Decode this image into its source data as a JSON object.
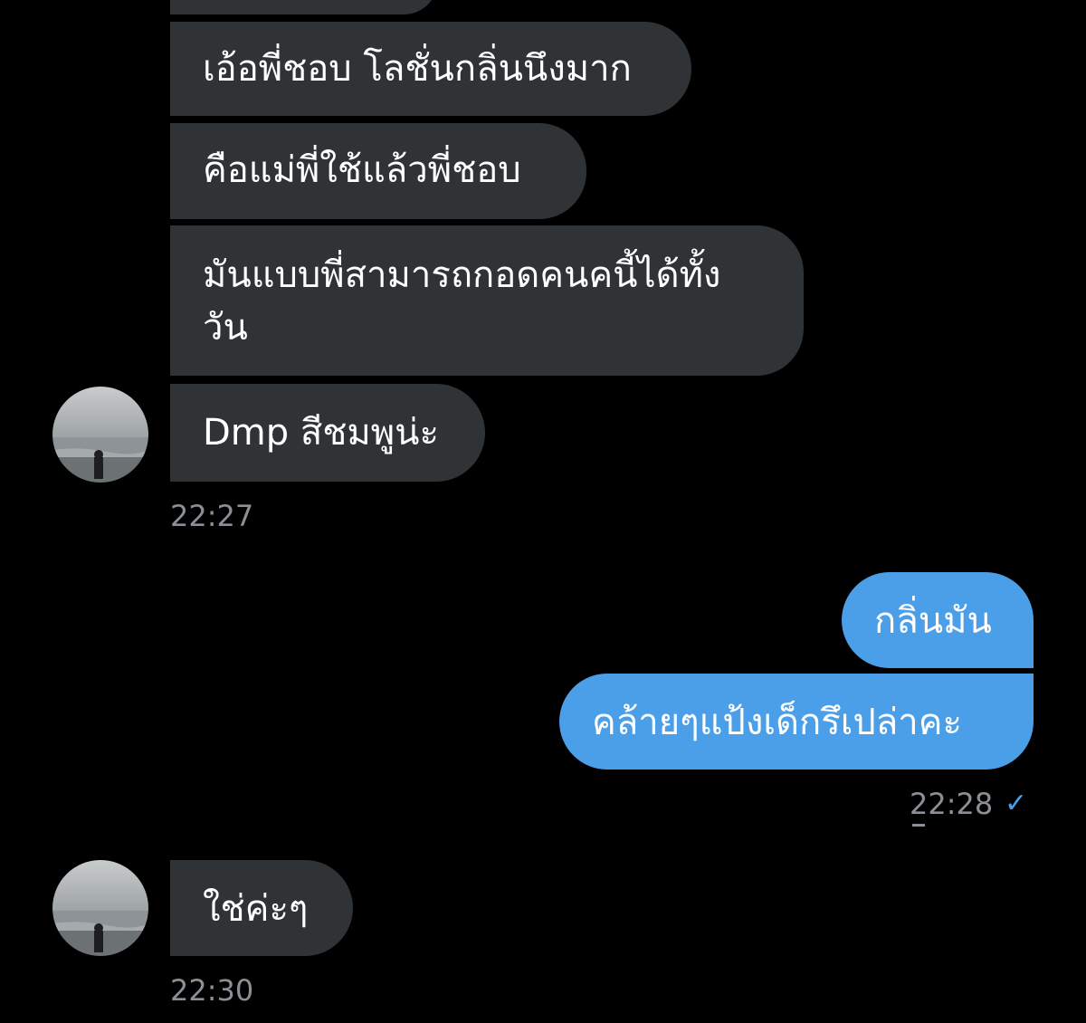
{
  "conversation": {
    "messages": [
      {
        "id": "m1",
        "sender": "other",
        "text": "เอ้อพี่ชอบ โลชั่นกลิ่นนึงมาก"
      },
      {
        "id": "m2",
        "sender": "other",
        "text": "คือแม่พี่ใช้แล้วพี่ชอบ"
      },
      {
        "id": "m3",
        "sender": "other",
        "lines": [
          "มันแบบพี่สามารถกอดคนคนี้ได้ทั้ง",
          "วัน"
        ]
      },
      {
        "id": "m4",
        "sender": "other",
        "text": "Dmp สีชมพูน่ะ"
      },
      {
        "id": "m5",
        "sender": "me",
        "text": "กลิ่นมัน"
      },
      {
        "id": "m6",
        "sender": "me",
        "text": "คล้ายๆแป้งเด็กรึเปล่าคะ"
      },
      {
        "id": "m7",
        "sender": "other",
        "text": "ใช่ค่ะๆ"
      }
    ],
    "timestamps": {
      "group1": "22:27",
      "group2": "22:28",
      "group3": "22:30"
    },
    "status": {
      "read_check": "✓"
    }
  },
  "colors": {
    "background": "#000000",
    "incoming_bubble": "#2f3336",
    "outgoing_bubble": "#4a9fe8",
    "timestamp": "#8b9096"
  },
  "icons": {
    "avatar": "avatar-photo-icon",
    "read_status": "checkmark-icon"
  }
}
